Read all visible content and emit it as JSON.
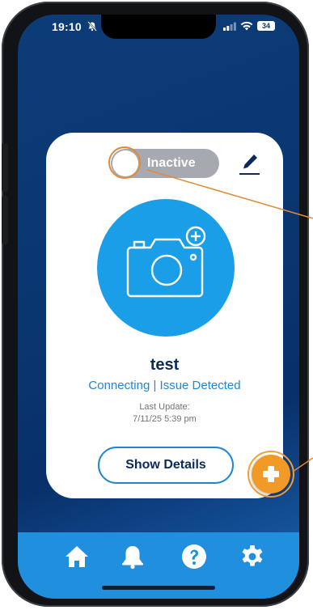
{
  "status_bar": {
    "time": "19:10",
    "battery": "34"
  },
  "card": {
    "toggle_label": "Inactive",
    "device_name": "test",
    "device_status": "Connecting | Issue Detected",
    "last_update_label": "Last Update:",
    "last_update_value": "7/11/25 5:39 pm",
    "details_button": "Show Details"
  },
  "colors": {
    "background": "#0a3670",
    "accent_blue": "#1b9ee8",
    "orange": "#f29a27",
    "nav_bar": "#1f8fde",
    "toggle_off": "#a6a9b0"
  },
  "icons": {
    "edit": "pencil-icon",
    "camera": "camera-add-icon",
    "fab": "plus-icon",
    "nav": [
      "home-icon",
      "bell-icon",
      "help-icon",
      "gear-icon"
    ]
  }
}
